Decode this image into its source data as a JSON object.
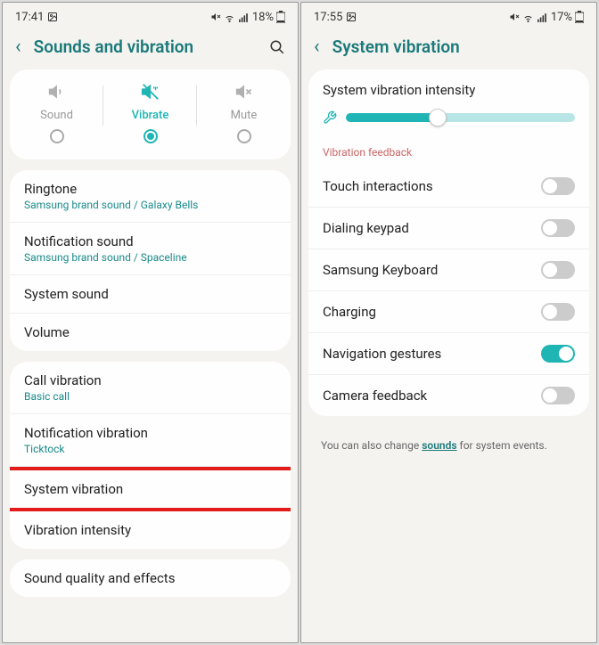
{
  "left": {
    "status": {
      "time": "17:41",
      "battery": "18%"
    },
    "header": {
      "title": "Sounds and vibration"
    },
    "modes": {
      "sound": "Sound",
      "vibrate": "Vibrate",
      "mute": "Mute"
    },
    "group1": {
      "ringtone": {
        "title": "Ringtone",
        "sub": "Samsung brand sound / Galaxy Bells"
      },
      "notification_sound": {
        "title": "Notification sound",
        "sub": "Samsung brand sound / Spaceline"
      },
      "system_sound": {
        "title": "System sound"
      },
      "volume": {
        "title": "Volume"
      }
    },
    "group2": {
      "call_vibration": {
        "title": "Call vibration",
        "sub": "Basic call"
      },
      "notification_vibration": {
        "title": "Notification vibration",
        "sub": "Ticktock"
      },
      "system_vibration": {
        "title": "System vibration"
      },
      "vibration_intensity": {
        "title": "Vibration intensity"
      }
    },
    "group3": {
      "sound_quality": {
        "title": "Sound quality and effects"
      }
    }
  },
  "right": {
    "status": {
      "time": "17:55",
      "battery": "17%"
    },
    "header": {
      "title": "System vibration"
    },
    "intensity": {
      "title": "System vibration intensity",
      "value": 40
    },
    "feedback_label": "Vibration feedback",
    "feedback": {
      "touch": {
        "title": "Touch interactions",
        "on": false
      },
      "dial": {
        "title": "Dialing keypad",
        "on": false
      },
      "keyboard": {
        "title": "Samsung Keyboard",
        "on": false
      },
      "charging": {
        "title": "Charging",
        "on": false
      },
      "nav": {
        "title": "Navigation gestures",
        "on": true
      },
      "camera": {
        "title": "Camera feedback",
        "on": false
      }
    },
    "footer": {
      "pre": "You can also change ",
      "link": "sounds",
      "post": " for system events."
    }
  }
}
